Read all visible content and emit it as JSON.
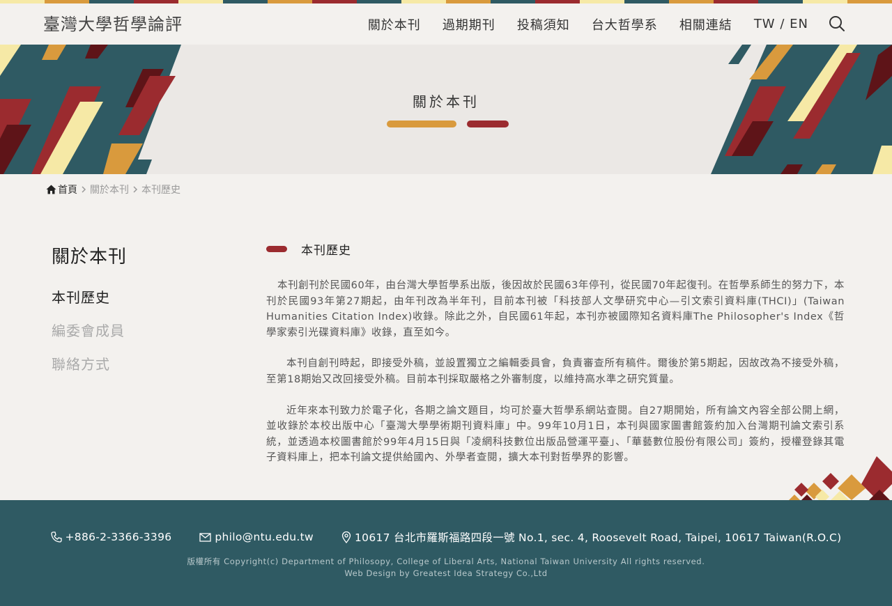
{
  "site": {
    "logo_text": "臺灣大學哲學論評"
  },
  "nav": {
    "items": [
      "關於本刊",
      "過期期刊",
      "投稿須知",
      "台大哲學系",
      "相關連結"
    ],
    "lang_tw": "TW",
    "lang_sep": "/",
    "lang_en": "EN"
  },
  "banner": {
    "title": "關於本刊"
  },
  "breadcrumb": {
    "home": "首頁",
    "parent": "關於本刊",
    "current": "本刊歷史"
  },
  "sidebar": {
    "title": "關於本刊",
    "items": [
      "本刊歷史",
      "編委會成員",
      "聯絡方式"
    ],
    "active_index": 0
  },
  "content": {
    "section_title": "本刊歷史",
    "paragraphs": [
      "本刊創刊於民國60年，由台灣大學哲學系出版，後因故於民國63年停刊，從民國70年起復刊。在哲學系師生的努力下，本刊於民國93年第27期起，由年刊改為半年刊，目前本刊被「科技部人文學研究中心—引文索引資料庫(THCI)」(Taiwan Humanities Citation Index)收錄。除此之外，自民國61年起，本刊亦被國際知名資料庫The Philosopher's Index《哲學家索引光碟資料庫》收錄，直至如今。",
      "本刊自創刊時起，即接受外稿，並設置獨立之編輯委員會，負責審查所有稿件。爾後於第5期起，因故改為不接受外稿，至第18期始又改回接受外稿。目前本刊採取嚴格之外審制度，以維持高水準之研究質量。",
      "近年來本刊致力於電子化，各期之論文題目，均可於臺大哲學系網站查閱。自27期開始，所有論文內容全部公開上網，並收錄於本校出版中心「臺灣大學學術期刊資料庫」中。99年10月1日，本刊與國家圖書館簽約加入台灣期刊論文索引系統，並透過本校圖書館於99年4月15日與「凌網科技數位出版品營運平臺」、「華藝數位股份有限公司」簽約，授權登錄其電子資料庫上，把本刊論文提供給國內、外學者查閱，擴大本刊對哲學界的影響。"
    ]
  },
  "footer": {
    "phone": "+886-2-3366-3396",
    "email": "philo@ntu.edu.tw",
    "address": "10617 台北市羅斯福路四段一號 No.1, sec. 4, Roosevelt Road, Taipei, 10617 Taiwan(R.O.C)",
    "copyright": "版權所有 Copyright(c) Department of Philosopy, College of Liberal Arts, National Taiwan University All rights reserved.",
    "design": "Web Design by Greatest Idea Strategy Co.,Ltd"
  },
  "colors": {
    "teal": "#2f5a63",
    "red": "#9b2b2f",
    "dark_red": "#5e1418",
    "gold": "#d99a3d",
    "cream": "#f6e9a6",
    "background": "#f3f1ee"
  }
}
